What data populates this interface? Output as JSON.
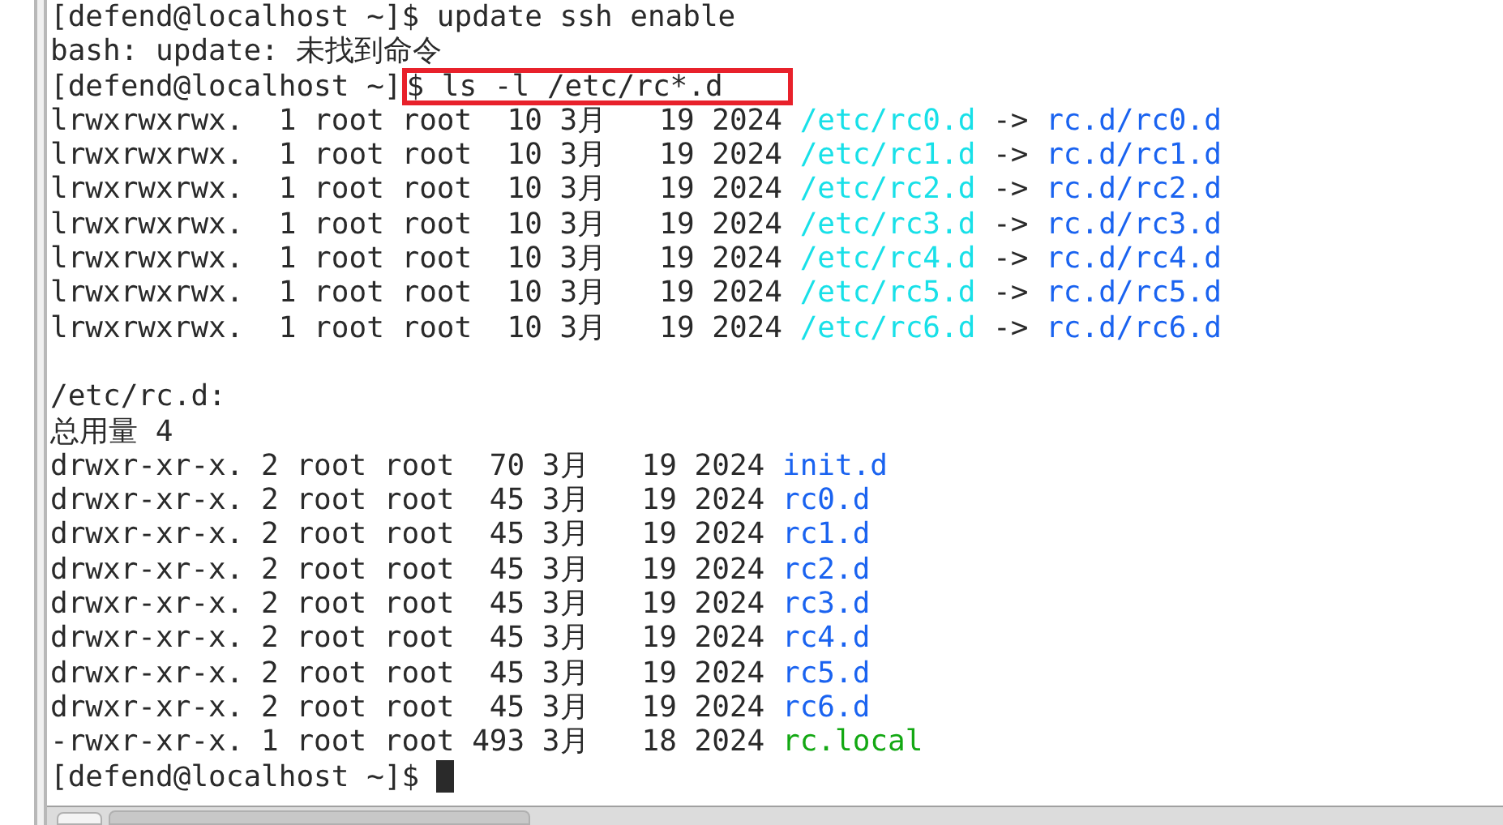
{
  "terminal": {
    "lines": [
      {
        "segments": [
          {
            "text": "[defend@localhost ~]$ update ssh enable",
            "kind": "plain"
          }
        ]
      },
      {
        "segments": [
          {
            "text": "bash: update: 未找到命令",
            "kind": "plain"
          }
        ]
      },
      {
        "segments": [
          {
            "text": "[defend@localhost ~]",
            "kind": "plain"
          },
          {
            "text": "$ ls -l /etc/rc*.d",
            "kind": "plain",
            "highlighted": true
          }
        ]
      },
      {
        "segments": [
          {
            "text": "lrwxrwxrwx.  1 root root  10 3月   19 2024 ",
            "kind": "plain"
          },
          {
            "text": "/etc/rc0.d",
            "kind": "link"
          },
          {
            "text": " -> ",
            "kind": "plain"
          },
          {
            "text": "rc.d/rc0.d",
            "kind": "dir"
          }
        ]
      },
      {
        "segments": [
          {
            "text": "lrwxrwxrwx.  1 root root  10 3月   19 2024 ",
            "kind": "plain"
          },
          {
            "text": "/etc/rc1.d",
            "kind": "link"
          },
          {
            "text": " -> ",
            "kind": "plain"
          },
          {
            "text": "rc.d/rc1.d",
            "kind": "dir"
          }
        ]
      },
      {
        "segments": [
          {
            "text": "lrwxrwxrwx.  1 root root  10 3月   19 2024 ",
            "kind": "plain"
          },
          {
            "text": "/etc/rc2.d",
            "kind": "link"
          },
          {
            "text": " -> ",
            "kind": "plain"
          },
          {
            "text": "rc.d/rc2.d",
            "kind": "dir"
          }
        ]
      },
      {
        "segments": [
          {
            "text": "lrwxrwxrwx.  1 root root  10 3月   19 2024 ",
            "kind": "plain"
          },
          {
            "text": "/etc/rc3.d",
            "kind": "link"
          },
          {
            "text": " -> ",
            "kind": "plain"
          },
          {
            "text": "rc.d/rc3.d",
            "kind": "dir"
          }
        ]
      },
      {
        "segments": [
          {
            "text": "lrwxrwxrwx.  1 root root  10 3月   19 2024 ",
            "kind": "plain"
          },
          {
            "text": "/etc/rc4.d",
            "kind": "link"
          },
          {
            "text": " -> ",
            "kind": "plain"
          },
          {
            "text": "rc.d/rc4.d",
            "kind": "dir"
          }
        ]
      },
      {
        "segments": [
          {
            "text": "lrwxrwxrwx.  1 root root  10 3月   19 2024 ",
            "kind": "plain"
          },
          {
            "text": "/etc/rc5.d",
            "kind": "link"
          },
          {
            "text": " -> ",
            "kind": "plain"
          },
          {
            "text": "rc.d/rc5.d",
            "kind": "dir"
          }
        ]
      },
      {
        "segments": [
          {
            "text": "lrwxrwxrwx.  1 root root  10 3月   19 2024 ",
            "kind": "plain"
          },
          {
            "text": "/etc/rc6.d",
            "kind": "link"
          },
          {
            "text": " -> ",
            "kind": "plain"
          },
          {
            "text": "rc.d/rc6.d",
            "kind": "dir"
          }
        ]
      },
      {
        "blank_line_before": true,
        "segments": [
          {
            "text": "/etc/rc.d:",
            "kind": "plain"
          }
        ]
      },
      {
        "segments": [
          {
            "text": "总用量 4",
            "kind": "plain"
          }
        ]
      },
      {
        "segments": [
          {
            "text": "drwxr-xr-x. 2 root root  70 3月   19 2024 ",
            "kind": "plain"
          },
          {
            "text": "init.d",
            "kind": "dir"
          }
        ]
      },
      {
        "segments": [
          {
            "text": "drwxr-xr-x. 2 root root  45 3月   19 2024 ",
            "kind": "plain"
          },
          {
            "text": "rc0.d",
            "kind": "dir"
          }
        ]
      },
      {
        "segments": [
          {
            "text": "drwxr-xr-x. 2 root root  45 3月   19 2024 ",
            "kind": "plain"
          },
          {
            "text": "rc1.d",
            "kind": "dir"
          }
        ]
      },
      {
        "segments": [
          {
            "text": "drwxr-xr-x. 2 root root  45 3月   19 2024 ",
            "kind": "plain"
          },
          {
            "text": "rc2.d",
            "kind": "dir"
          }
        ]
      },
      {
        "segments": [
          {
            "text": "drwxr-xr-x. 2 root root  45 3月   19 2024 ",
            "kind": "plain"
          },
          {
            "text": "rc3.d",
            "kind": "dir"
          }
        ]
      },
      {
        "segments": [
          {
            "text": "drwxr-xr-x. 2 root root  45 3月   19 2024 ",
            "kind": "plain"
          },
          {
            "text": "rc4.d",
            "kind": "dir"
          }
        ]
      },
      {
        "segments": [
          {
            "text": "drwxr-xr-x. 2 root root  45 3月   19 2024 ",
            "kind": "plain"
          },
          {
            "text": "rc5.d",
            "kind": "dir"
          }
        ]
      },
      {
        "segments": [
          {
            "text": "drwxr-xr-x. 2 root root  45 3月   19 2024 ",
            "kind": "plain"
          },
          {
            "text": "rc6.d",
            "kind": "dir"
          }
        ]
      },
      {
        "segments": [
          {
            "text": "-rwxr-xr-x. 1 root root 493 3月   18 2024 ",
            "kind": "plain"
          },
          {
            "text": "rc.local",
            "kind": "exec"
          }
        ]
      },
      {
        "segments": [
          {
            "text": "[defend@localhost ~]$ ",
            "kind": "plain"
          }
        ],
        "cursor": true
      }
    ]
  }
}
